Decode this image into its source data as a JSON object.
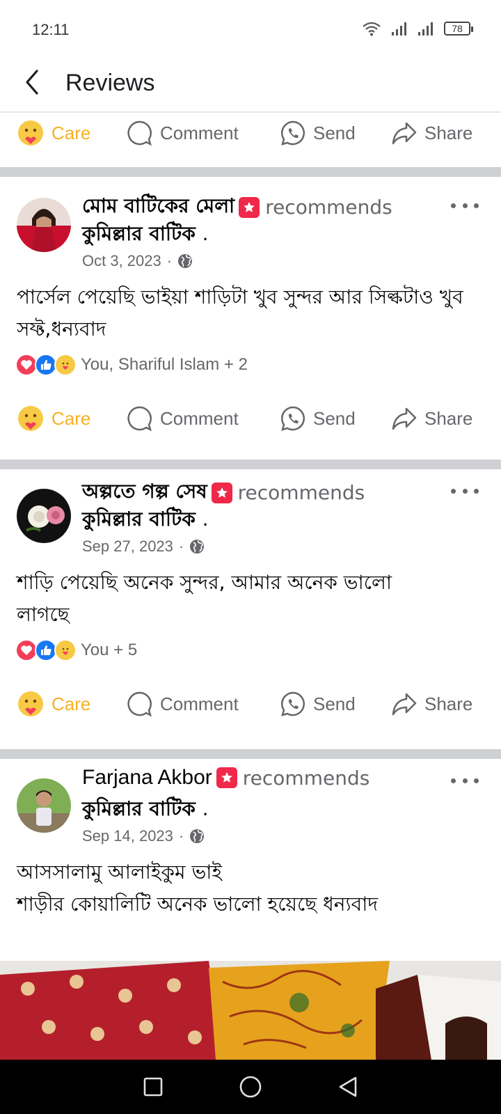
{
  "status": {
    "time": "12:11",
    "battery": "78"
  },
  "header": {
    "title": "Reviews"
  },
  "actions": {
    "care": "Care",
    "comment": "Comment",
    "send": "Send",
    "share": "Share"
  },
  "page_name": "কুমিল্লার বাটিক",
  "page_suffix": ".",
  "recommends_label": "recommends",
  "posts": [
    {
      "author": "মোম বাটিকের মেলা",
      "date": "Oct 3, 2023",
      "text": "পার্সেল পেয়েছি ভাইয়া শাড়িটা খুব সুন্দর আর সিল্কটাও খুব সফ্ট,ধন্যবাদ",
      "reactions": "You, Shariful Islam + 2"
    },
    {
      "author": "অল্পতে গল্প সেষ",
      "date": "Sep 27, 2023",
      "text": "শাড়ি পেয়েছি অনেক সুন্দর, আমার অনেক ভালো লাগছে",
      "reactions": "You + 5"
    },
    {
      "author": "Farjana Akbor",
      "date": "Sep 14, 2023",
      "text_line1": "আসসালামু আলাইকুম ভাই",
      "text_line2": "শাড়ীর কোয়ালিটি অনেক ভালো হয়েছে ধন্যবাদ"
    }
  ],
  "colors": {
    "care": "#f7b125",
    "secondary": "#65676b",
    "divider": "#ced0d4",
    "badge": "#f02849",
    "like": "#1877f2",
    "love": "#f33e58"
  },
  "icons": [
    "back-arrow-icon",
    "care-icon",
    "comment-icon",
    "messenger-send-icon",
    "share-icon",
    "globe-icon",
    "more-dots-icon",
    "recommend-badge-icon",
    "wifi-icon",
    "signal-icon",
    "battery-icon"
  ]
}
